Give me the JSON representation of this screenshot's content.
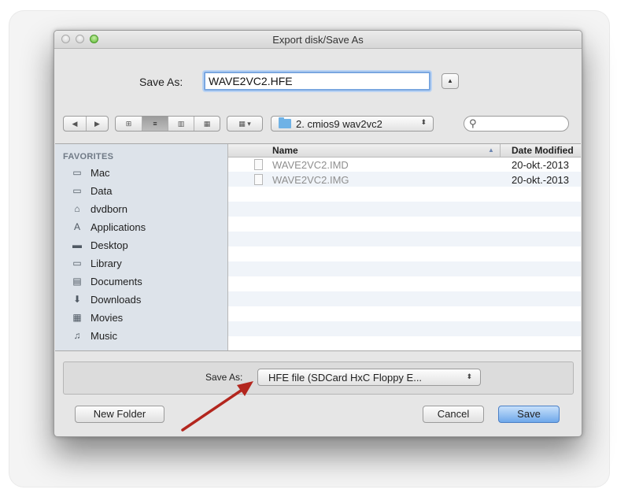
{
  "window": {
    "title": "Export disk/Save As"
  },
  "save_row": {
    "label": "Save As:",
    "filename": "WAVE2VC2.HFE",
    "expand_glyph": "▲"
  },
  "toolbar": {
    "back_glyph": "◀",
    "forward_glyph": "▶",
    "view_glyphs": [
      "⊞",
      "≡",
      "▥",
      "▦"
    ],
    "arrange_glyph": "▦ ▾",
    "location": "2. cmios9 wav2vc2",
    "location_arrows": "⬍",
    "search_glyph": "⚲",
    "search_value": ""
  },
  "sidebar": {
    "title": "FAVORITES",
    "items": [
      {
        "label": "Mac",
        "icon": "hard-drive-icon",
        "glyph": "▭"
      },
      {
        "label": "Data",
        "icon": "hard-drive-icon",
        "glyph": "▭"
      },
      {
        "label": "dvdborn",
        "icon": "home-icon",
        "glyph": "⌂"
      },
      {
        "label": "Applications",
        "icon": "applications-icon",
        "glyph": "A"
      },
      {
        "label": "Desktop",
        "icon": "desktop-icon",
        "glyph": "▬"
      },
      {
        "label": "Library",
        "icon": "folder-icon",
        "glyph": "▭"
      },
      {
        "label": "Documents",
        "icon": "documents-icon",
        "glyph": "▤"
      },
      {
        "label": "Downloads",
        "icon": "downloads-icon",
        "glyph": "⬇"
      },
      {
        "label": "Movies",
        "icon": "movies-icon",
        "glyph": "▦"
      },
      {
        "label": "Music",
        "icon": "music-icon",
        "glyph": "♫"
      }
    ]
  },
  "file_list": {
    "columns": [
      "Name",
      "Date Modified"
    ],
    "sort_glyph": "▲",
    "rows": [
      {
        "name": "WAVE2VC2.IMD",
        "date": "20-okt.-2013"
      },
      {
        "name": "WAVE2VC2.IMG",
        "date": "20-okt.-2013"
      }
    ]
  },
  "format": {
    "label": "Save As:",
    "value": "HFE file (SDCard HxC Floppy E...",
    "arrows": "⬍"
  },
  "buttons": {
    "new_folder": "New Folder",
    "cancel": "Cancel",
    "save": "Save"
  },
  "colors": {
    "annotation_arrow": "#b3261e",
    "default_button": "#6fa8ea",
    "sidebar_bg": "#dde3ea"
  }
}
